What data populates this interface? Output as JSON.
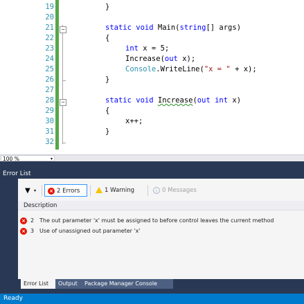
{
  "editor": {
    "line_numbers": [
      "19",
      "20",
      "21",
      "22",
      "23",
      "24",
      "25",
      "26",
      "27",
      "28",
      "29",
      "30",
      "31",
      "32"
    ],
    "lines": {
      "l19": "}",
      "l21_kw1": "static",
      "l21_kw2": "void",
      "l21_rest1": " Main(",
      "l21_kw3": "string",
      "l21_rest2": "[] args)",
      "l22": "{",
      "l23_kw": "int",
      "l23_rest": " x = 5;",
      "l24_pre": "Increase(",
      "l24_kw": "out",
      "l24_post": " x);",
      "l25_cls": "Console",
      "l25_mid": ".WriteLine(",
      "l25_str": "\"x = \"",
      "l25_post": " + x);",
      "l26": "}",
      "l28_kw1": "static",
      "l28_kw2": "void",
      "l28_name": "Increase",
      "l28_open": "(",
      "l28_kw3": "out",
      "l28_kw4": "int",
      "l28_rest": " x)",
      "l29": "{",
      "l30": "x++;",
      "l31": "}"
    },
    "fold_glyph": "−",
    "change_bar_color": "#57a64a"
  },
  "zoom": {
    "value": "100 %",
    "arrow": "▾"
  },
  "error_list": {
    "title": "Error List",
    "filter_icon": "▼",
    "filter_dropdown": "▾",
    "errors_button": {
      "count_label": "2 Errors",
      "icon": "×"
    },
    "warnings_button": {
      "count_label": "1 Warning"
    },
    "messages_button": {
      "count_label": "0 Messages",
      "icon": "i"
    },
    "column_description": "Description",
    "rows": [
      {
        "num": "2",
        "message": "The out parameter 'x' must be assigned to before control leaves the current method",
        "icon": "×"
      },
      {
        "num": "3",
        "message": "Use of unassigned out parameter 'x'",
        "icon": "×"
      }
    ]
  },
  "tabs": {
    "error_list": "Error List",
    "output": "Output",
    "package_manager": "Package Manager Console"
  },
  "status": {
    "text": "Ready"
  },
  "colors": {
    "accent": "#007acc",
    "panel": "#293955",
    "error": "#e51400",
    "warning": "#f7c300"
  }
}
